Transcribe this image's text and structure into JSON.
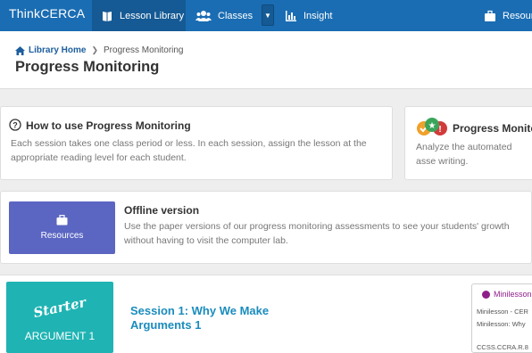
{
  "nav": {
    "brand": "ThinkCERCA",
    "items": [
      {
        "label": "Lesson Library",
        "icon": "book-icon"
      },
      {
        "label": "Classes",
        "icon": "users-icon"
      },
      {
        "label": "Insight",
        "icon": "bar-chart-icon"
      },
      {
        "label": "Resour",
        "icon": "briefcase-icon"
      }
    ],
    "dropdown_icon": "caret-down-icon",
    "colors": {
      "bar": "#1a6db3",
      "active": "#155a94"
    }
  },
  "breadcrumb": {
    "home": "Library Home",
    "current": "Progress Monitoring"
  },
  "page_title": "Progress Monitoring",
  "howto": {
    "title": "How to use Progress Monitoring",
    "body": "Each session takes one class period or less. In each session, assign the lesson at the appropriate reading level for each student.",
    "icon": "question-circle-icon"
  },
  "promo": {
    "title": "Progress Monito",
    "body": "Analyze the automated asse writing.",
    "icon": "badges-icon"
  },
  "offline": {
    "title": "Offline version",
    "body": "Use the paper versions of our progress monitoring assessments to see your students' growth without having to visit the computer lab.",
    "button_label": "Resources",
    "button_color": "#5b66c2"
  },
  "session": {
    "tile_badge": "Starter",
    "tile_label": "ARGUMENT 1",
    "tile_color": "#1fb3b3",
    "title_line1": "Session 1: Why We Make",
    "title_line2": "Arguments 1",
    "minilesson": {
      "header": "Minilesson",
      "line1": "Minilesson - CER",
      "line2": "Minilesson: Why",
      "standard": "CCSS.CCRA.R.8"
    }
  }
}
